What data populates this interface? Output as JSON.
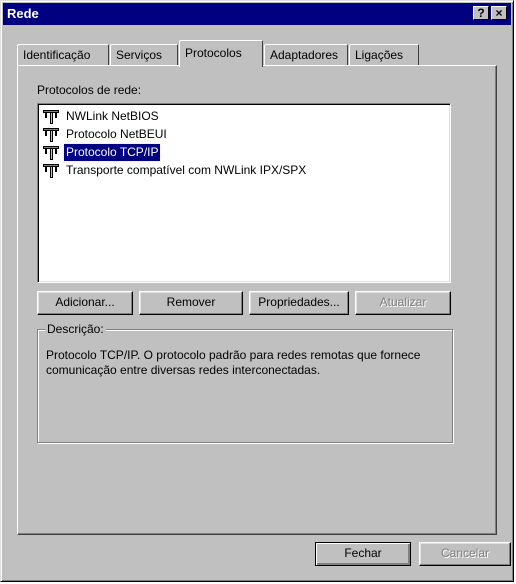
{
  "window": {
    "title": "Rede",
    "help_glyph": "?",
    "close_glyph": "×"
  },
  "tabs": [
    {
      "label": "Identificação",
      "active": false
    },
    {
      "label": "Serviços",
      "active": false
    },
    {
      "label": "Protocolos",
      "active": true
    },
    {
      "label": "Adaptadores",
      "active": false
    },
    {
      "label": "Ligações",
      "active": false
    }
  ],
  "protocols": {
    "label": "Protocolos de rede:",
    "items": [
      {
        "label": "NWLink NetBIOS",
        "icon": "network-protocol-icon",
        "selected": false
      },
      {
        "label": "Protocolo NetBEUI",
        "icon": "network-protocol-icon",
        "selected": false
      },
      {
        "label": "Protocolo TCP/IP",
        "icon": "network-protocol-icon",
        "selected": true
      },
      {
        "label": "Transporte compatível com NWLink IPX/SPX",
        "icon": "network-protocol-icon",
        "selected": false
      }
    ]
  },
  "actions": {
    "add": "Adicionar...",
    "remove": "Remover",
    "properties": "Propriedades...",
    "update": "Atualizar"
  },
  "description": {
    "caption": "Descrição:",
    "text": "Protocolo TCP/IP. O protocolo padrão para redes remotas que fornece comunicação entre diversas redes interconectadas."
  },
  "footer": {
    "close": "Fechar",
    "cancel": "Cancelar"
  },
  "colors": {
    "titlebar": "#000080",
    "face": "#c0c0c0",
    "selection": "#000080"
  }
}
